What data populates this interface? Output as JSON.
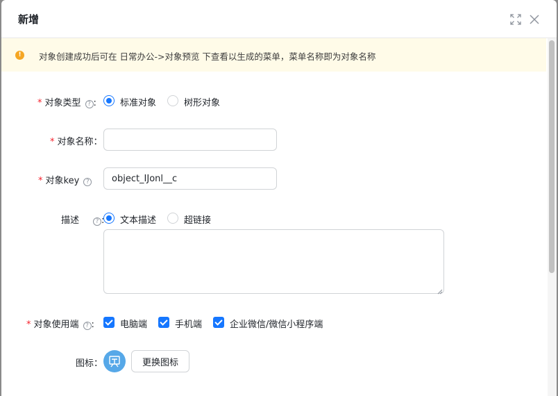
{
  "dialog": {
    "title": "新增"
  },
  "alert": {
    "text": "对象创建成功后可在 日常办公->对象预览 下查看以生成的菜单，菜单名称即为对象名称"
  },
  "form": {
    "object_type": {
      "label": "对象类型",
      "colon": ":",
      "options": [
        "标准对象",
        "树形对象"
      ],
      "selected": "标准对象"
    },
    "object_name": {
      "label": "对象名称",
      "colon": "：",
      "value": ""
    },
    "object_key": {
      "label": "对象key",
      "value": "object_IJonl__c"
    },
    "description": {
      "label": "描述",
      "colon": ":",
      "options": [
        "文本描述",
        "超链接"
      ],
      "selected": "文本描述",
      "value": ""
    },
    "clients": {
      "label": "对象使用端",
      "colon": ":",
      "options": [
        "电脑端",
        "手机端",
        "企业微信/微信小程序端"
      ],
      "checked": [
        "电脑端",
        "手机端",
        "企业微信/微信小程序端"
      ]
    },
    "icon": {
      "label": "图标",
      "colon": "：",
      "change_button": "更换图标"
    }
  },
  "colors": {
    "accent": "#1677ff",
    "required": "#f5222d",
    "alert_bg": "#fffbe8",
    "warning": "#f5a623",
    "icon_bg": "#56a8e8"
  }
}
